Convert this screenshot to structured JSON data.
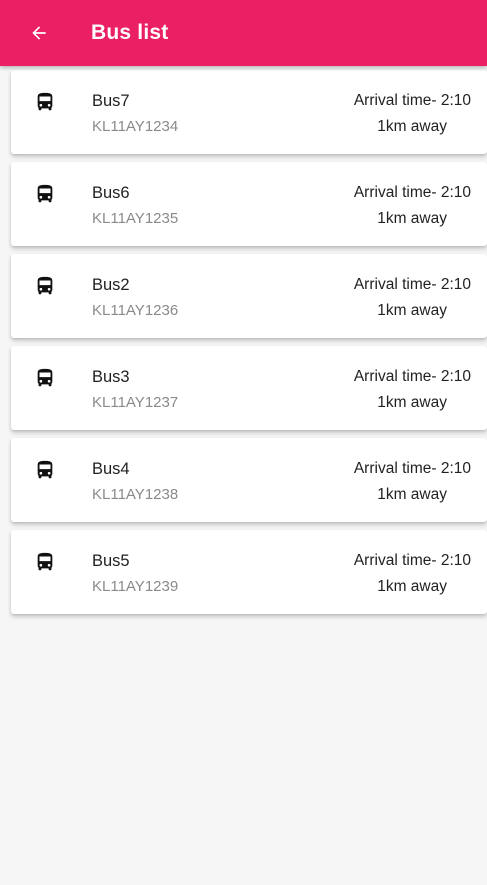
{
  "app_bar": {
    "title": "Bus list",
    "color": "#eb1f63",
    "back_icon": "arrow-left-icon"
  },
  "buses": [
    {
      "name": "Bus7",
      "plate": "KL11AY1234",
      "arrival": "Arrival time- 2:10",
      "distance": "1km away",
      "icon": "bus-icon"
    },
    {
      "name": "Bus6",
      "plate": "KL11AY1235",
      "arrival": "Arrival time- 2:10",
      "distance": "1km away",
      "icon": "bus-icon"
    },
    {
      "name": "Bus2",
      "plate": "KL11AY1236",
      "arrival": "Arrival time- 2:10",
      "distance": "1km away",
      "icon": "bus-icon"
    },
    {
      "name": "Bus3",
      "plate": "KL11AY1237",
      "arrival": "Arrival time- 2:10",
      "distance": "1km away",
      "icon": "bus-icon"
    },
    {
      "name": "Bus4",
      "plate": "KL11AY1238",
      "arrival": "Arrival time- 2:10",
      "distance": "1km away",
      "icon": "bus-icon"
    },
    {
      "name": "Bus5",
      "plate": "KL11AY1239",
      "arrival": "Arrival time- 2:10",
      "distance": "1km away",
      "icon": "bus-icon"
    }
  ]
}
